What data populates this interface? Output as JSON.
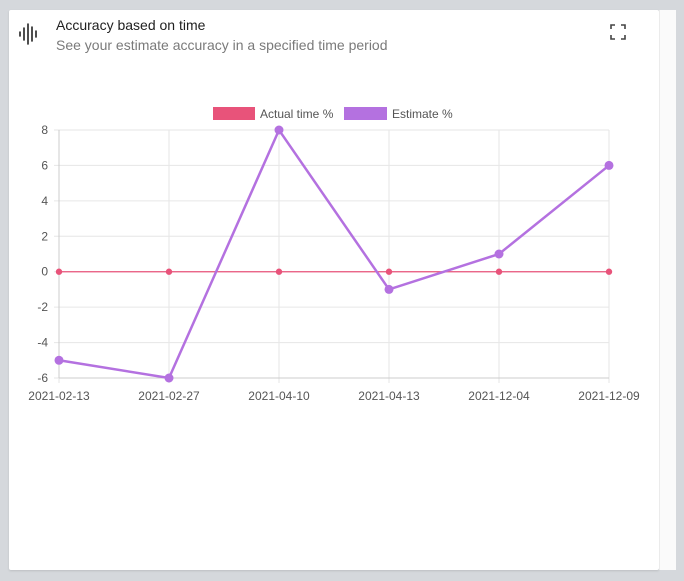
{
  "header": {
    "title": "Accuracy based on time",
    "subtitle": "See your estimate accuracy in a specified time period",
    "icon": "audio-waveform-icon",
    "expand_icon": "fullscreen-expand-icon"
  },
  "chart_data": {
    "type": "line",
    "categories": [
      "2021-02-13",
      "2021-02-27",
      "2021-04-10",
      "2021-04-13",
      "2021-12-04",
      "2021-12-09"
    ],
    "series": [
      {
        "name": "Actual time %",
        "values": [
          0,
          0,
          0,
          0,
          0,
          0
        ],
        "color": "#e8537a"
      },
      {
        "name": "Estimate %",
        "values": [
          -5,
          -6,
          8,
          -1,
          1,
          6
        ],
        "color": "#b471e0"
      }
    ],
    "title": "",
    "xlabel": "",
    "ylabel": "",
    "ylim": [
      -6,
      8
    ],
    "yticks": [
      8,
      6,
      4,
      2,
      0,
      -2,
      -4,
      -6
    ],
    "grid": true,
    "legend": "top"
  },
  "colors": {
    "grid": "#e6e6e6",
    "axis": "#cccccc"
  }
}
